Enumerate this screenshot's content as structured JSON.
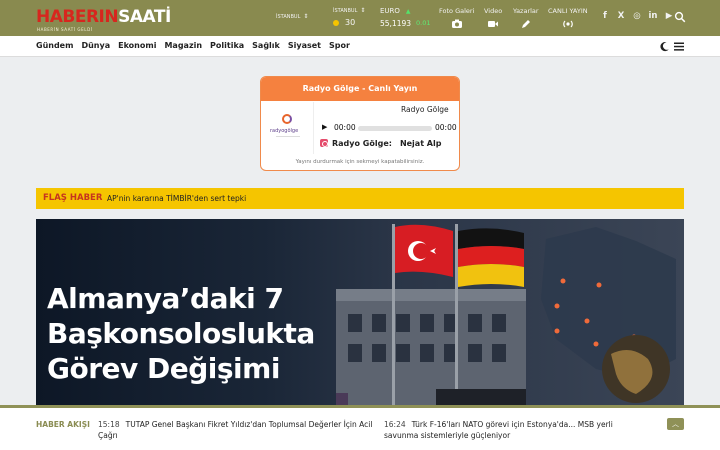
{
  "header": {
    "logo_part1": "HABERIN",
    "logo_part2": "SAATİ",
    "logo_sub": "HABERİN SAATİ GELDİ",
    "location_select": "İSTANBUL",
    "weather": {
      "city": "İSTANBUL",
      "temp": "30",
      "icon": "sun-icon"
    },
    "currency": {
      "name": "EURO",
      "value": "55,1193",
      "change": "0.01",
      "trend": "up-arrow-icon"
    },
    "quick_links": [
      {
        "label": "Foto Galeri",
        "icon": "camera-icon"
      },
      {
        "label": "Video",
        "icon": "video-icon"
      },
      {
        "label": "Yazarlar",
        "icon": "pen-icon"
      },
      {
        "label": "CANLI YAYIN",
        "icon": "broadcast-icon"
      }
    ],
    "socials": [
      "facebook-icon",
      "x-icon",
      "instagram-icon",
      "linkedin-icon",
      "youtube-icon"
    ],
    "colors": {
      "bar": "#898a4f",
      "logo_red": "#d7261e"
    }
  },
  "nav": {
    "items": [
      "Gündem",
      "Dünya",
      "Ekonomi",
      "Magazin",
      "Politika",
      "Sağlık",
      "Siyaset",
      "Spor"
    ]
  },
  "radio": {
    "title": "Radyo Gölge - Canlı Yayın",
    "station": "Radyo Gölge",
    "logo_text": "radyogölge",
    "time_current": "00:00",
    "time_total": "00:00",
    "now_playing_label": "Radyo Gölge:",
    "now_playing_song": "Nejat Alp",
    "footer": "Yayını durdurmak için sekmeyi kapatabilirsiniz."
  },
  "flash": {
    "label": "FLAŞ HABER",
    "text": "AP'nin kararına TİMBİR'den sert tepki"
  },
  "hero": {
    "title": "Almanya’daki 7 Başkonsoloslukta Görev Değişimi"
  },
  "ticker": {
    "label": "HABER AKIŞI",
    "items": [
      {
        "time": "15:18",
        "text": "TUTAP Genel Başkanı Fikret Yıldız'dan Toplumsal Değerler İçin Acil Çağrı"
      },
      {
        "time": "16:24",
        "text": "Türk F-16'ları NATO görevi için Estonya'da... MSB yerli savunma sistemleriyle güçleniyor"
      }
    ]
  }
}
